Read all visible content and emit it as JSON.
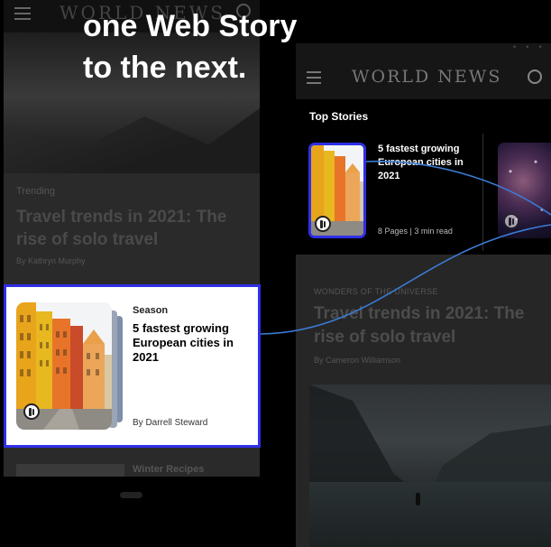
{
  "headline_overlay": {
    "line1": "one Web Story",
    "line2": "to the next."
  },
  "left_phone": {
    "brand": "WORLD NEWS",
    "trending_label": "Trending",
    "headline": "Travel trends in 2021: The rise of solo travel",
    "author": "By Kathryn Murphy",
    "bottom_label": "Winter Recipes"
  },
  "highlight_card": {
    "category": "Season",
    "title": "5 fastest growing European cities in 2021",
    "author": "By Darrell Steward"
  },
  "right_phone": {
    "brand": "WORLD NEWS",
    "top_stories_label": "Top Stories",
    "story_title": "5 fastest growing European cities in 2021",
    "story_meta": "8 Pages | 3 min read",
    "kicker": "WONDERS OF THE UNIVERSE",
    "headline": "Travel trends in 2021: The rise of solo travel",
    "author": "By Cameron Williamson"
  },
  "colors": {
    "accent_blue": "#2f2fe8",
    "connector_blue": "#3a7bd5"
  },
  "icons": [
    "menu-icon",
    "user-icon",
    "web-story-icon"
  ]
}
